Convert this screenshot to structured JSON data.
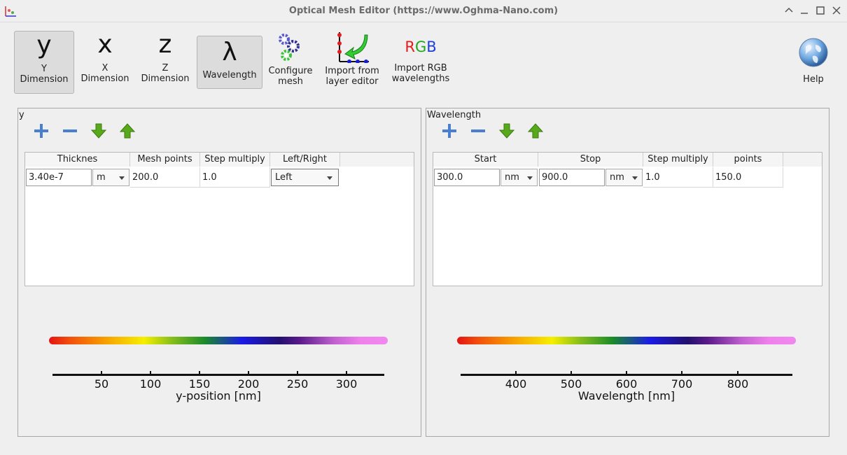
{
  "window": {
    "title": "Optical Mesh Editor (https://www.Oghma-Nano.com)"
  },
  "toolbar": {
    "y_glyph": "y",
    "y_label1": "Y",
    "y_label2": "Dimension",
    "x_glyph": "x",
    "x_label1": "X",
    "x_label2": "Dimension",
    "z_glyph": "z",
    "z_label1": "Z",
    "z_label2": "Dimension",
    "wl_glyph": "λ",
    "wl_label": "Wavelength",
    "configure_label1": "Configure",
    "configure_label2": "mesh",
    "import_label1": "Import from",
    "import_label2": "layer editor",
    "rgb_r": "R",
    "rgb_g": "G",
    "rgb_b": "B",
    "rgb_label1": "Import RGB",
    "rgb_label2": "wavelengths",
    "help_label": "Help"
  },
  "y_panel": {
    "title": "y",
    "headers": [
      "Thicknes",
      "Mesh points",
      "Step multiply",
      "Left/Right"
    ],
    "row": {
      "thickness": "3.40e-7",
      "unit": "m",
      "mesh_points": "200.0",
      "step_multiply": "1.0",
      "left_right": "Left"
    },
    "ticks": [
      "50",
      "100",
      "150",
      "200",
      "250",
      "300"
    ],
    "axis_title": "y-position [nm]"
  },
  "wl_panel": {
    "title": "Wavelength",
    "headers": [
      "Start",
      "Stop",
      "Step multiply",
      "points"
    ],
    "row": {
      "start": "300.0",
      "start_unit": "nm",
      "stop": "900.0",
      "stop_unit": "nm",
      "step_multiply": "1.0",
      "points": "150.0"
    },
    "ticks": [
      "400",
      "500",
      "600",
      "700",
      "800"
    ],
    "axis_title": "Wavelength [nm]"
  },
  "colors": {
    "accent_green": "#58a81c",
    "accent_blue": "#4a7fcf"
  }
}
